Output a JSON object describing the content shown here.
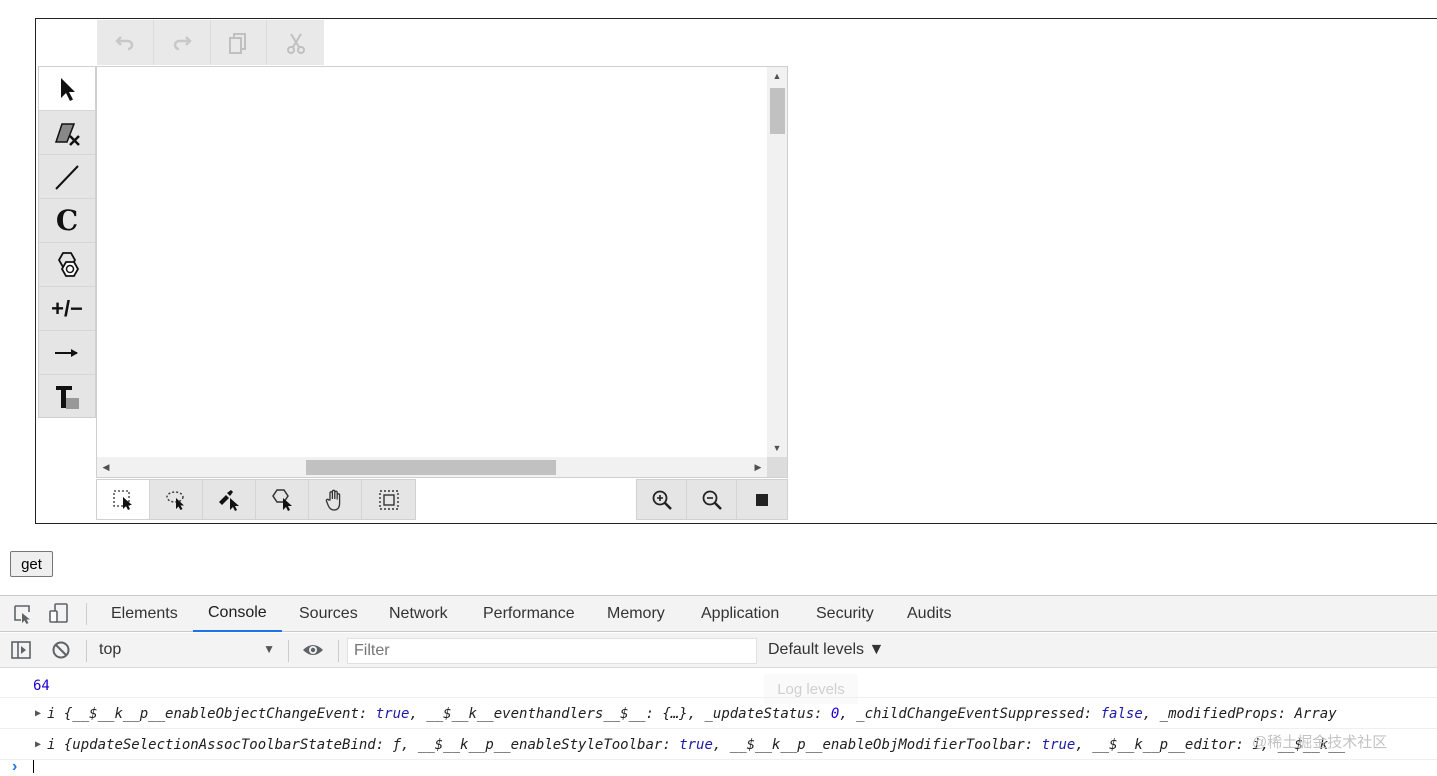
{
  "editor": {
    "top_toolbar": [
      "undo-icon",
      "redo-icon",
      "copy-icon",
      "cut-icon"
    ],
    "left_toolbar": [
      "select-arrow-icon",
      "eraser-icon",
      "bond-line-icon",
      "carbon-atom-icon",
      "ring-template-icon",
      "charge-icon",
      "reaction-arrow-icon",
      "text-icon"
    ],
    "left_toolbar_c_label": "C",
    "left_toolbar_charge_label": "+/−",
    "bottom_toolbar": [
      "rect-select-icon",
      "lasso-select-icon",
      "brush-select-icon",
      "fragment-select-icon",
      "pan-hand-icon",
      "select-all-icon"
    ],
    "zoom_toolbar": [
      "zoom-in-icon",
      "zoom-out-icon",
      "reset-zoom-icon"
    ]
  },
  "get_button": {
    "label": "get"
  },
  "devtools": {
    "tabs": [
      "Elements",
      "Console",
      "Sources",
      "Network",
      "Performance",
      "Memory",
      "Application",
      "Security",
      "Audits"
    ],
    "active_tab": "Console",
    "context": "top",
    "filter_placeholder": "Filter",
    "levels": "Default levels ▼",
    "levels_tooltip": "Log levels",
    "accent_color": "#1a73e8",
    "console": {
      "number_output": "64",
      "obj1": {
        "prefix": "i {",
        "parts": [
          {
            "t": "__$__k__p__enableObjectChangeEvent: ",
            "c": "obj"
          },
          {
            "t": "true",
            "c": "kw"
          },
          {
            "t": ", __$__k__eventhandlers__$__: {…}, _updateStatus: ",
            "c": "obj"
          },
          {
            "t": "0",
            "c": "num"
          },
          {
            "t": ", _childChangeEventSuppressed: ",
            "c": "obj"
          },
          {
            "t": "false",
            "c": "kw"
          },
          {
            "t": ", _modifiedProps: Array",
            "c": "obj"
          }
        ]
      },
      "obj2": {
        "prefix": "i {",
        "parts": [
          {
            "t": "updateSelectionAssocToolbarStateBind: ",
            "c": "obj"
          },
          {
            "t": "ƒ",
            "c": "obj"
          },
          {
            "t": ", __$__k__p__enableStyleToolbar: ",
            "c": "obj"
          },
          {
            "t": "true",
            "c": "kw"
          },
          {
            "t": ", __$__k__p__enableObjModifierToolbar: ",
            "c": "obj"
          },
          {
            "t": "true",
            "c": "kw"
          },
          {
            "t": ", __$__k__p__editor: i, __$__k__",
            "c": "obj"
          }
        ]
      },
      "prompt": "›"
    }
  },
  "watermark": "@稀土掘金技术社区"
}
